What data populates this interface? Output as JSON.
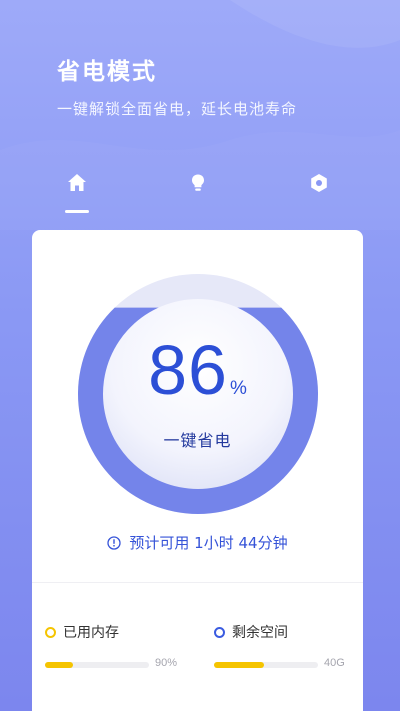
{
  "header": {
    "title": "省电模式",
    "subtitle": "一键解锁全面省电，延长电池寿命"
  },
  "tabs": [
    {
      "icon": "home-icon",
      "active": true
    },
    {
      "icon": "lightbulb-icon",
      "active": false
    },
    {
      "icon": "hexagon-settings-icon",
      "active": false
    }
  ],
  "battery": {
    "percent_value": "86",
    "percent_unit": "%",
    "action_label": "一键省电",
    "level_fraction": 0.86
  },
  "estimate": {
    "icon": "info-circle-icon",
    "text": "预计可用 1小时 44分钟"
  },
  "stats": {
    "memory": {
      "label": "已用内存",
      "value": "90%",
      "fraction": 0.27
    },
    "space": {
      "label": "剩余空间",
      "value": "40G",
      "fraction": 0.48
    }
  },
  "colors": {
    "accent": "#3553D8",
    "yellow": "#F5C400",
    "background": "#8A98F4"
  }
}
